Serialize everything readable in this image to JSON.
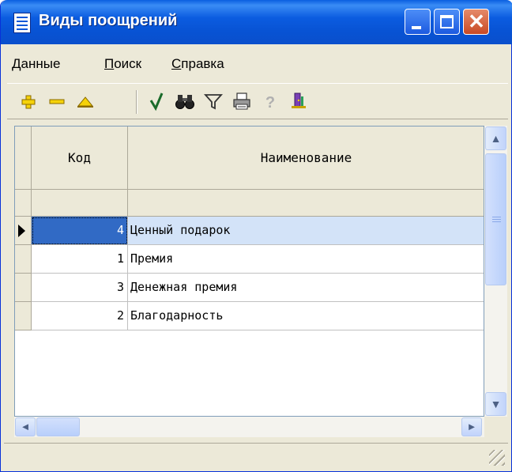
{
  "window": {
    "title": "Виды поощрений",
    "accent_color": "#0a5fe0",
    "icons": {
      "app": "list-document-icon",
      "minimize": "minimize-icon",
      "maximize": "maximize-icon",
      "close": "close-icon"
    }
  },
  "menu": {
    "items": [
      {
        "accel": "Д",
        "rest": "анные"
      },
      {
        "accel": "П",
        "rest": "оиск"
      },
      {
        "accel": "С",
        "rest": "правка"
      }
    ]
  },
  "toolbar": {
    "tools": [
      "add-icon",
      "delete-icon",
      "edit-icon",
      "apply-checkmark-icon",
      "find-binoculars-icon",
      "filter-funnel-icon",
      "print-icon",
      "help-icon",
      "exit-door-icon"
    ]
  },
  "grid": {
    "headers": [
      "Код",
      "Наименование"
    ],
    "rows": [
      {
        "code": "4",
        "name": "Ценный подарок"
      },
      {
        "code": "1",
        "name": "Премия"
      },
      {
        "code": "3",
        "name": "Денежная премия"
      },
      {
        "code": "2",
        "name": "Благодарность"
      }
    ],
    "selected_row": 0,
    "selection_color": "#316ac5"
  },
  "scrollbars": {
    "up": "▲",
    "down": "▼",
    "left": "◄",
    "right": "►"
  }
}
